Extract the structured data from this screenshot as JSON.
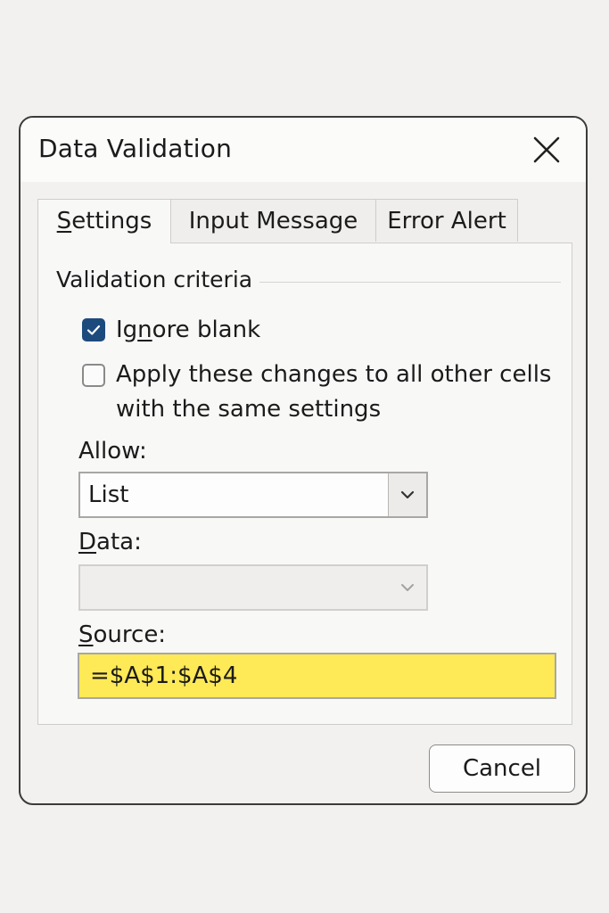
{
  "dialog": {
    "title": "Data Validation",
    "close_icon": "close-icon",
    "tabs": [
      {
        "label": "Settings",
        "accel": "S",
        "rest": "ettings",
        "active": true
      },
      {
        "label": "Input Message",
        "active": false
      },
      {
        "label": "Error Alert",
        "active": false
      }
    ],
    "group_label": "Validation criteria",
    "ignore_blank": {
      "pre": "Ig",
      "accel": "n",
      "post": "ore blank",
      "checked": true
    },
    "apply_all": {
      "line1": "Apply these changes to all other cells",
      "line2": "with the same settings",
      "checked": false
    },
    "allow": {
      "label": "Allow:",
      "value": "List"
    },
    "data": {
      "accel": "D",
      "rest": "ata:",
      "value": ""
    },
    "source": {
      "accel": "S",
      "rest": "ource:",
      "value": "=$A$1:$A$4"
    },
    "cancel_label": "Cancel"
  },
  "colors": {
    "accent": "#1d4a7d",
    "source_highlight": "#fee956"
  }
}
